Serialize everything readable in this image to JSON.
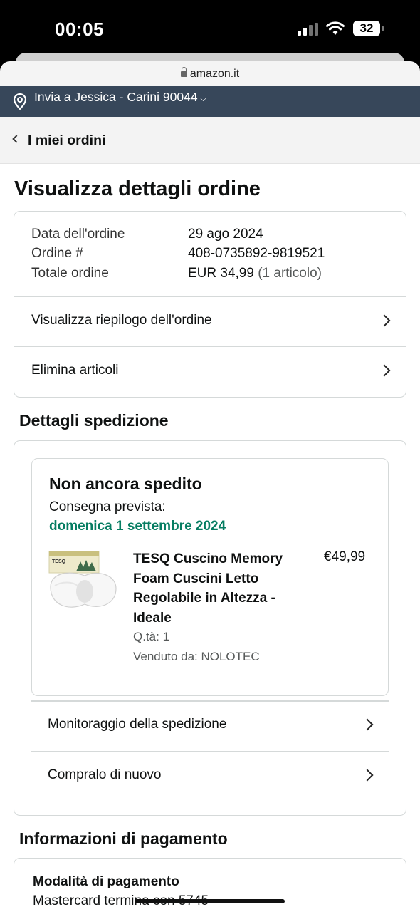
{
  "status_bar": {
    "time": "00:05",
    "battery": "32"
  },
  "browser": {
    "url": "amazon.it"
  },
  "delivery": {
    "text": "Invia a Jessica - Carini 90044"
  },
  "nav": {
    "back_label": "I miei ordini"
  },
  "page": {
    "title": "Visualizza dettagli ordine"
  },
  "order_summary": {
    "date_label": "Data dell'ordine",
    "date_value": "29 ago 2024",
    "number_label": "Ordine #",
    "number_value": "408-0735892-9819521",
    "total_label": "Totale ordine",
    "total_value": "EUR 34,99",
    "total_items": "(1 articolo)",
    "view_summary": "Visualizza riepilogo dell'ordine",
    "remove_items": "Elimina articoli"
  },
  "shipping": {
    "section_title": "Dettagli spedizione",
    "status": "Non ancora spedito",
    "expected_label": "Consegna prevista:",
    "expected_date": "domenica 1 settembre 2024",
    "product": {
      "title": "TESQ Cuscino Memory Foam Cuscini Letto Regolabile in Altezza - Ideale",
      "price": "€49,99",
      "qty": "Q.tà: 1",
      "seller": "Venduto da: NOLOTEC",
      "box_brand": "TESQ"
    },
    "track_label": "Monitoraggio della spedizione",
    "buy_again_label": "Compralo di nuovo"
  },
  "payment": {
    "section_title": "Informazioni di pagamento",
    "method_label": "Modalità di pagamento",
    "method_value": "Mastercard termina con 5745"
  },
  "colors": {
    "nav_bg": "#37475a",
    "delivery_green": "#067d62",
    "border": "#d5d9d9"
  }
}
